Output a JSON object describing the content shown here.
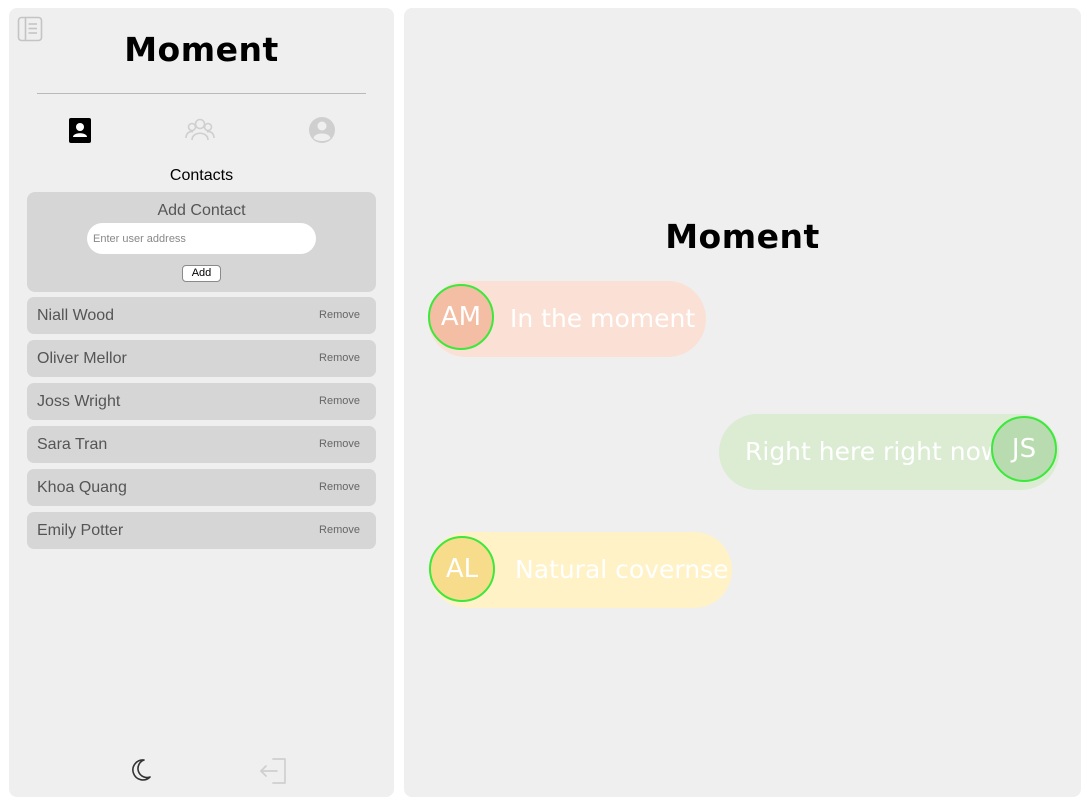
{
  "sidebar": {
    "brand": "Moment",
    "nav": [
      {
        "id": "contacts",
        "icon": "contact-book-icon",
        "active": true
      },
      {
        "id": "groups",
        "icon": "group-icon",
        "active": false
      },
      {
        "id": "profile",
        "icon": "user-circle-icon",
        "active": false
      }
    ],
    "section_title": "Contacts",
    "add_contact": {
      "title": "Add Contact",
      "placeholder": "Enter user address",
      "value": "",
      "button_label": "Add"
    },
    "contacts": [
      {
        "name": "Niall Wood",
        "remove_label": "Remove"
      },
      {
        "name": "Oliver Mellor",
        "remove_label": "Remove"
      },
      {
        "name": "Joss Wright",
        "remove_label": "Remove"
      },
      {
        "name": "Sara Tran",
        "remove_label": "Remove"
      },
      {
        "name": "Khoa Quang",
        "remove_label": "Remove"
      },
      {
        "name": "Emily Potter",
        "remove_label": "Remove"
      }
    ],
    "footer": {
      "theme_icon": "moon-icon",
      "logout_icon": "logout-icon"
    }
  },
  "main": {
    "brand": "Moment",
    "bubbles": [
      {
        "initials": "AM",
        "text": "In the moment",
        "color": "#fbe1d5",
        "avatar_color": "#f3bea3",
        "align": "left"
      },
      {
        "initials": "JS",
        "text": "Right here right now",
        "color": "#dbecd3",
        "avatar_color": "#b8dcaf",
        "align": "right"
      },
      {
        "initials": "AL",
        "text": "Natural covernse",
        "color": "#fef2c6",
        "avatar_color": "#f7dc8c",
        "align": "left"
      }
    ],
    "avatar_ring_color": "#3ce83c"
  },
  "colors": {
    "panel": "#efefef",
    "card": "#d6d6d6",
    "inactive_icon": "#cfcfcf"
  }
}
